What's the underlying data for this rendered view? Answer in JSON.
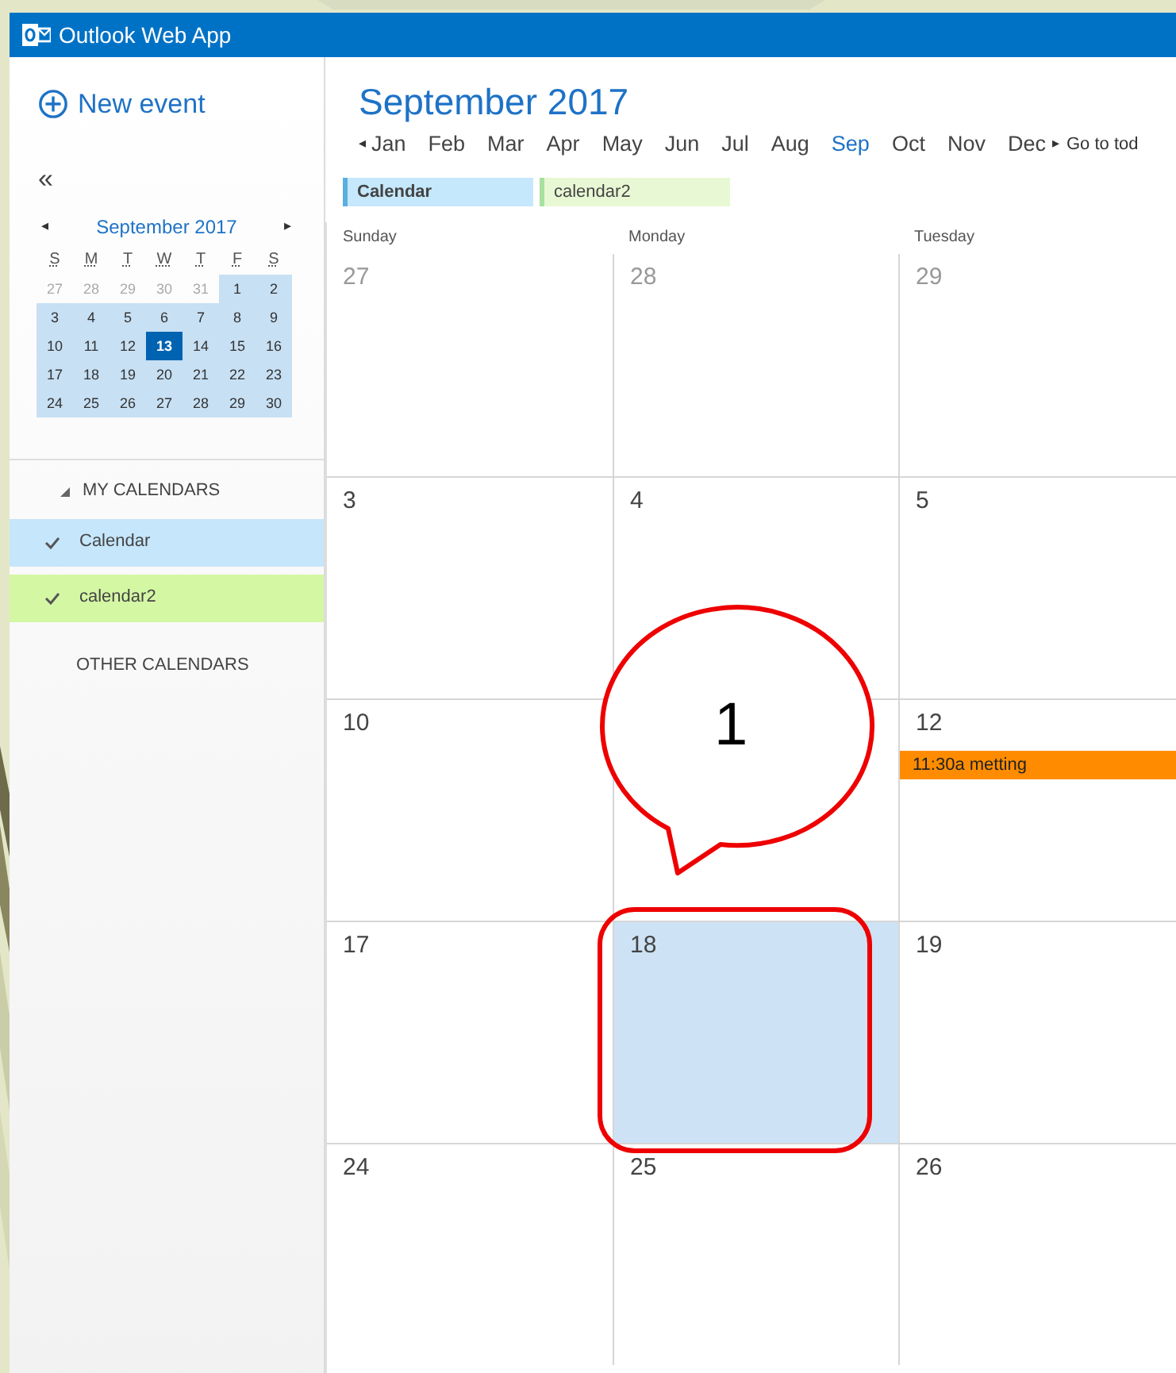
{
  "window": {
    "title": "Outlook Web App"
  },
  "sidebar": {
    "new_event": "New event",
    "collapse": "«",
    "mini_calendar": {
      "title": "September 2017",
      "prev": "◂",
      "next": "▸",
      "weekdays": [
        "S",
        "M",
        "T",
        "W",
        "T",
        "F",
        "S"
      ],
      "weeks": [
        [
          {
            "label": "27",
            "muted": true,
            "selected": false
          },
          {
            "label": "28",
            "muted": true,
            "selected": false
          },
          {
            "label": "29",
            "muted": true,
            "selected": false
          },
          {
            "label": "30",
            "muted": true,
            "selected": false
          },
          {
            "label": "31",
            "muted": true,
            "selected": false
          },
          {
            "label": "1",
            "muted": false,
            "selected": false
          },
          {
            "label": "2",
            "muted": false,
            "selected": false
          }
        ],
        [
          {
            "label": "3",
            "muted": false,
            "selected": false
          },
          {
            "label": "4",
            "muted": false,
            "selected": false
          },
          {
            "label": "5",
            "muted": false,
            "selected": false
          },
          {
            "label": "6",
            "muted": false,
            "selected": false
          },
          {
            "label": "7",
            "muted": false,
            "selected": false
          },
          {
            "label": "8",
            "muted": false,
            "selected": false
          },
          {
            "label": "9",
            "muted": false,
            "selected": false
          }
        ],
        [
          {
            "label": "10",
            "muted": false,
            "selected": false
          },
          {
            "label": "11",
            "muted": false,
            "selected": false
          },
          {
            "label": "12",
            "muted": false,
            "selected": false
          },
          {
            "label": "13",
            "muted": false,
            "selected": true
          },
          {
            "label": "14",
            "muted": false,
            "selected": false
          },
          {
            "label": "15",
            "muted": false,
            "selected": false
          },
          {
            "label": "16",
            "muted": false,
            "selected": false
          }
        ],
        [
          {
            "label": "17",
            "muted": false,
            "selected": false
          },
          {
            "label": "18",
            "muted": false,
            "selected": false
          },
          {
            "label": "19",
            "muted": false,
            "selected": false
          },
          {
            "label": "20",
            "muted": false,
            "selected": false
          },
          {
            "label": "21",
            "muted": false,
            "selected": false
          },
          {
            "label": "22",
            "muted": false,
            "selected": false
          },
          {
            "label": "23",
            "muted": false,
            "selected": false
          }
        ],
        [
          {
            "label": "24",
            "muted": false,
            "selected": false
          },
          {
            "label": "25",
            "muted": false,
            "selected": false
          },
          {
            "label": "26",
            "muted": false,
            "selected": false
          },
          {
            "label": "27",
            "muted": false,
            "selected": false
          },
          {
            "label": "28",
            "muted": false,
            "selected": false
          },
          {
            "label": "29",
            "muted": false,
            "selected": false
          },
          {
            "label": "30",
            "muted": false,
            "selected": false
          }
        ]
      ]
    },
    "my_calendars": {
      "label": "MY CALENDARS",
      "expanded": true,
      "items": [
        {
          "name": "Calendar",
          "checked": true,
          "color": "#c5e6fb"
        },
        {
          "name": "calendar2",
          "checked": true,
          "color": "#d4f7a4"
        }
      ]
    },
    "other_calendars": {
      "label": "OTHER CALENDARS"
    }
  },
  "main": {
    "title": "September 2017",
    "prev": "◂",
    "next": "▸",
    "months": [
      {
        "label": "Jan",
        "selected": false
      },
      {
        "label": "Feb",
        "selected": false
      },
      {
        "label": "Mar",
        "selected": false
      },
      {
        "label": "Apr",
        "selected": false
      },
      {
        "label": "May",
        "selected": false
      },
      {
        "label": "Jun",
        "selected": false
      },
      {
        "label": "Jul",
        "selected": false
      },
      {
        "label": "Aug",
        "selected": false
      },
      {
        "label": "Sep",
        "selected": true
      },
      {
        "label": "Oct",
        "selected": false
      },
      {
        "label": "Nov",
        "selected": false
      },
      {
        "label": "Dec",
        "selected": false
      }
    ],
    "go_to_today": "Go to tod",
    "calendar_tabs": [
      {
        "name": "Calendar",
        "selected": true,
        "color": "#c5e8fc"
      },
      {
        "name": "calendar2",
        "selected": false,
        "color": "#e8f8d4"
      }
    ],
    "weekdays": [
      "Sunday",
      "Monday",
      "Tuesday"
    ],
    "weeks": [
      [
        {
          "day": "27",
          "muted": true,
          "selected": false
        },
        {
          "day": "28",
          "muted": true,
          "selected": false
        },
        {
          "day": "29",
          "muted": true,
          "selected": false
        }
      ],
      [
        {
          "day": "3",
          "muted": false,
          "selected": false
        },
        {
          "day": "4",
          "muted": false,
          "selected": false
        },
        {
          "day": "5",
          "muted": false,
          "selected": false
        }
      ],
      [
        {
          "day": "10",
          "muted": false,
          "selected": false
        },
        {
          "selected": false
        },
        {
          "day": "12",
          "muted": false,
          "selected": false,
          "events": [
            {
              "title": "11:30a metting",
              "color": "#ff8c00"
            }
          ]
        }
      ],
      [
        {
          "day": "17",
          "muted": false,
          "selected": false
        },
        {
          "day": "18",
          "muted": false,
          "selected": true
        },
        {
          "day": "19",
          "muted": false,
          "selected": false
        }
      ],
      [
        {
          "day": "24",
          "muted": false,
          "selected": false
        },
        {
          "day": "25",
          "muted": false,
          "selected": false
        },
        {
          "day": "26",
          "muted": false,
          "selected": false
        }
      ]
    ]
  },
  "annotation": {
    "label": "1"
  }
}
